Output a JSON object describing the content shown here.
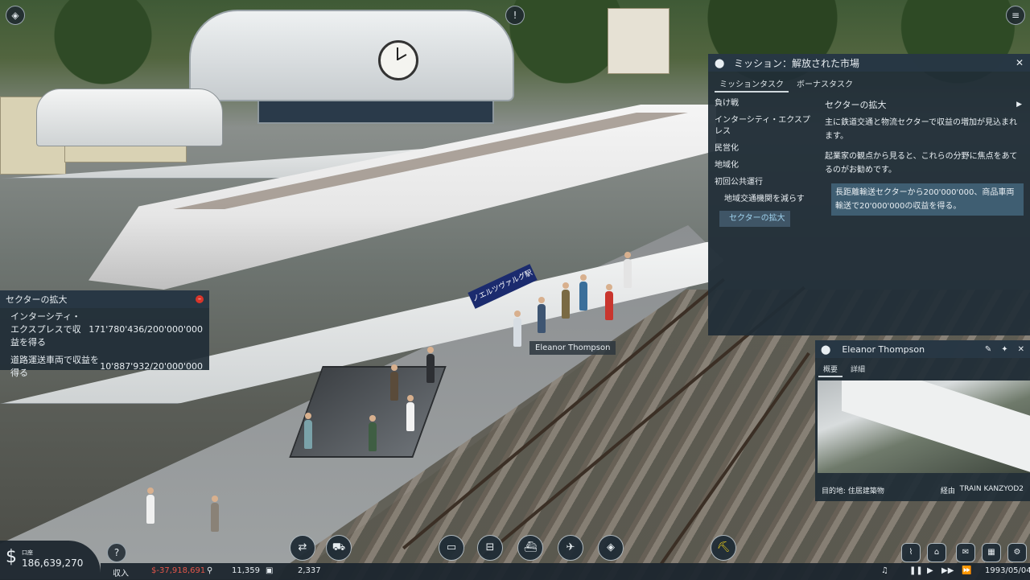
{
  "mission": {
    "title": "ミッション：解放された市場",
    "tabs": [
      "ミッションタスク",
      "ボーナスタスク"
    ],
    "task_list": [
      "負け戦",
      "インターシティ・エクスプレス",
      "民営化",
      "地域化",
      "初回公共運行",
      "地域交通機関を減らす"
    ],
    "selected_task": "セクターの拡大",
    "detail_title": "セクターの拡大",
    "detail_p1": "主に鉄道交通と物流セクターで収益の増加が見込まれます。",
    "detail_p2": "起業家の観点から見ると、これらの分野に焦点をあてるのがお勧めです。",
    "detail_task": "長距離輸送セクターから200'000'000、商品車両輸送で20'000'000の収益を得る。"
  },
  "progress": {
    "title": "セクターの拡大",
    "rows": [
      {
        "label": "インターシティ・エクスプレスで収益を得る",
        "value": "171'780'436/200'000'000"
      },
      {
        "label": "道路運送車両で収益を得る",
        "value": "10'887'932/20'000'000"
      }
    ]
  },
  "tooltip": "Eleanor Thompson",
  "person": {
    "name": "Eleanor Thompson",
    "tabs": [
      "概要",
      "詳細"
    ],
    "dest_label": "目的地:",
    "dest_value": "住居建築物",
    "via_label": "経由",
    "via_value": "TRAIN KANZYOD2"
  },
  "sign_text": "ノエルツヴァルグ駅",
  "finance": {
    "account_label": "口座",
    "balance": "186,639,270",
    "income_label": "収入",
    "income_value": "$-37,918,691",
    "stat1": "11,359",
    "stat2": "2,337",
    "date": "1993/05/04"
  },
  "colors": {
    "negative": "#e4564a",
    "accent": "#9fd2ee"
  }
}
